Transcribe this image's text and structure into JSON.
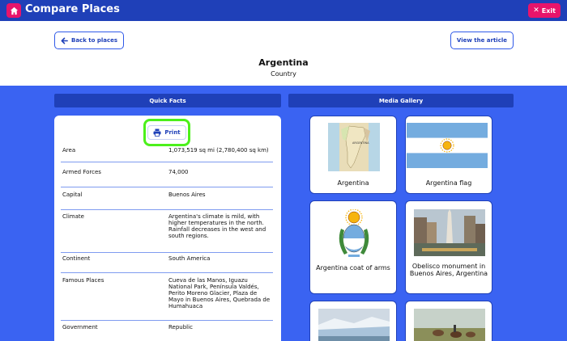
{
  "topbar": {
    "title": "Compare Places",
    "exit_label": "Exit"
  },
  "header": {
    "back_label": "Back to places",
    "article_label": "View the article",
    "place_name": "Argentina",
    "place_type": "Country"
  },
  "sections": {
    "quick_facts": "Quick Facts",
    "media_gallery": "Media Gallery"
  },
  "print_label": "Print",
  "facts": [
    {
      "label": "Area",
      "value": "1,073,519 sq mi (2,780,400 sq km)"
    },
    {
      "label": "Armed Forces",
      "value": "74,000"
    },
    {
      "label": "Capital",
      "value": "Buenos Aires"
    },
    {
      "label": "Climate",
      "value": "Argentina's climate is mild, with higher temperatures in the north. Rainfall decreases in the west and south regions."
    },
    {
      "label": "Continent",
      "value": "South America"
    },
    {
      "label": "Famous Places",
      "value": "Cueva de las Manos, Iguazu National Park, Península Valdés, Perito Moreno Glacier, Plaza de Mayo in Buenos Aires, Quebrada de Humahuaca"
    },
    {
      "label": "Government",
      "value": "Republic"
    }
  ],
  "gallery": [
    {
      "caption": "Argentina"
    },
    {
      "caption": "Argentina flag"
    },
    {
      "caption": "Argentina coat of arms"
    },
    {
      "caption": "Obelisco monument in Buenos Aires, Argentina"
    },
    {
      "caption": ""
    },
    {
      "caption": ""
    }
  ],
  "map_label": "ARGENTINA",
  "colors": {
    "brand": "#1f40b8",
    "accent": "#e8146b",
    "highlight": "#4cf01b",
    "background": "#3a63f2"
  }
}
